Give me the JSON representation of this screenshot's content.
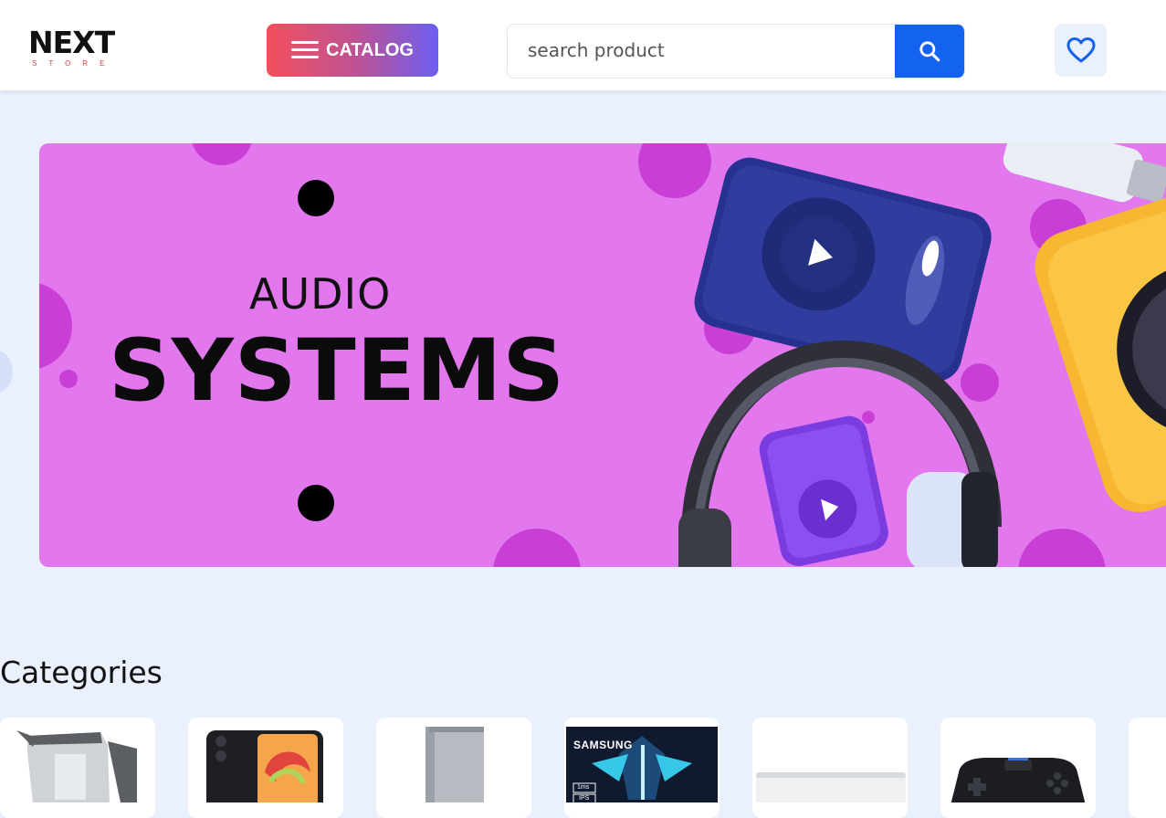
{
  "header": {
    "logo": {
      "main": "NEXT",
      "sub": "STORE"
    },
    "catalog_label": "CATALOG",
    "search": {
      "placeholder": "search product",
      "value": ""
    },
    "accent": "#1463f0"
  },
  "banner": {
    "line1": "AUDIO",
    "line2": "SYSTEMS",
    "background": "#e277ee"
  },
  "categories": {
    "title": "Categories",
    "items": [
      {
        "icon": "kettle-icon"
      },
      {
        "icon": "smartphone-icon"
      },
      {
        "icon": "refrigerator-icon"
      },
      {
        "icon": "monitor-icon",
        "brand": "SAMSUNG",
        "spec1": "1ms",
        "spec2": "IPS"
      },
      {
        "icon": "appliance-icon"
      },
      {
        "icon": "gamepad-icon"
      },
      {
        "icon": "category-icon"
      }
    ]
  }
}
